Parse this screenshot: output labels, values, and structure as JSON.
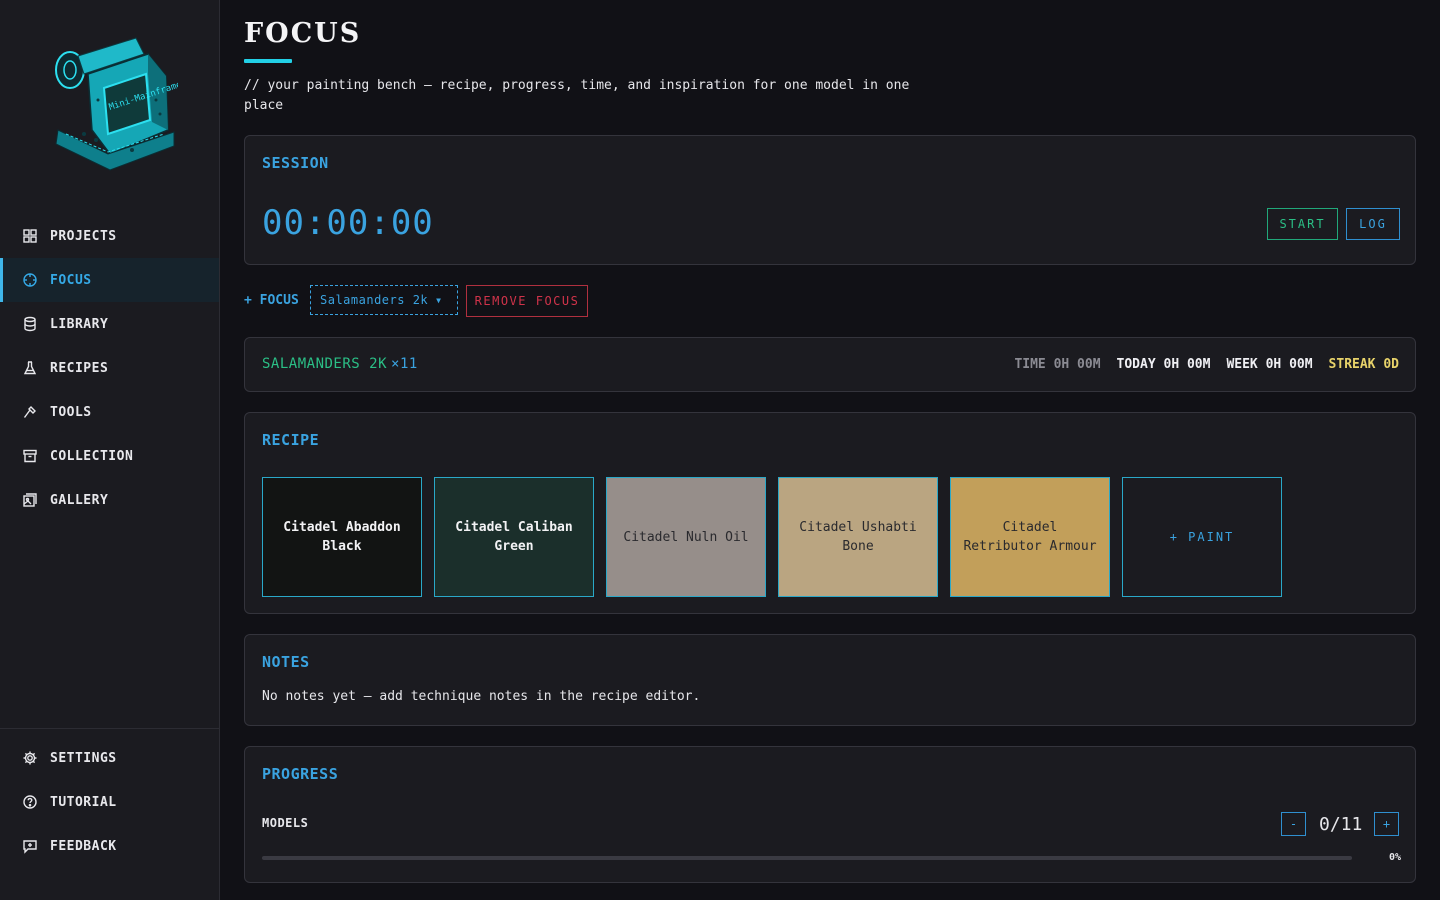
{
  "sidebar": {
    "logo_text": "Mini-Mainframe",
    "items": [
      {
        "label": "PROJECTS",
        "icon": "grid-icon"
      },
      {
        "label": "FOCUS",
        "icon": "crosshair-icon",
        "active": true
      },
      {
        "label": "LIBRARY",
        "icon": "database-icon"
      },
      {
        "label": "RECIPES",
        "icon": "flask-icon"
      },
      {
        "label": "TOOLS",
        "icon": "hammer-icon"
      },
      {
        "label": "COLLECTION",
        "icon": "archive-icon"
      },
      {
        "label": "GALLERY",
        "icon": "image-icon"
      }
    ],
    "bottom_items": [
      {
        "label": "SETTINGS",
        "icon": "gear-icon"
      },
      {
        "label": "TUTORIAL",
        "icon": "help-icon"
      },
      {
        "label": "FEEDBACK",
        "icon": "feedback-icon"
      }
    ]
  },
  "header": {
    "title": "FOCUS",
    "subtitle": "// your painting bench — recipe, progress, time, and inspiration for one model in one place"
  },
  "session": {
    "title": "SESSION",
    "timer": "00:00:00",
    "start_label": "START",
    "log_label": "LOG"
  },
  "focus_bar": {
    "label": "+ FOCUS",
    "selected": "Salamanders 2k",
    "remove_label": "REMOVE FOCUS"
  },
  "project": {
    "name": "SALAMANDERS 2K",
    "count": "×11",
    "time": "TIME 0H 00M",
    "today": "TODAY 0H 00M",
    "week": "WEEK 0H 00M",
    "streak": "STREAK 0D"
  },
  "recipe": {
    "title": "RECIPE",
    "paints": [
      {
        "name": "Citadel Abaddon Black",
        "color": "#121413",
        "tone": "dark"
      },
      {
        "name": "Citadel Caliban Green",
        "color": "#1b2f2b",
        "tone": "dark"
      },
      {
        "name": "Citadel Nuln Oil",
        "color": "#968e8a",
        "tone": "light"
      },
      {
        "name": "Citadel Ushabti Bone",
        "color": "#baa581",
        "tone": "light"
      },
      {
        "name": "Citadel Retributor Armour",
        "color": "#c29f5a",
        "tone": "light"
      }
    ],
    "add_label": "+ PAINT"
  },
  "notes": {
    "title": "NOTES",
    "text": "No notes yet — add technique notes in the recipe editor."
  },
  "progress": {
    "title": "PROGRESS",
    "models_label": "MODELS",
    "decrement": "-",
    "increment": "+",
    "count": "0/11",
    "fraction": 0,
    "percent": "0%"
  },
  "colors": {
    "accent": "#3aa3e0",
    "green": "#2bbf86",
    "danger": "#d0334a",
    "streak": "#e8d36a",
    "logo": "#22d0e6"
  }
}
